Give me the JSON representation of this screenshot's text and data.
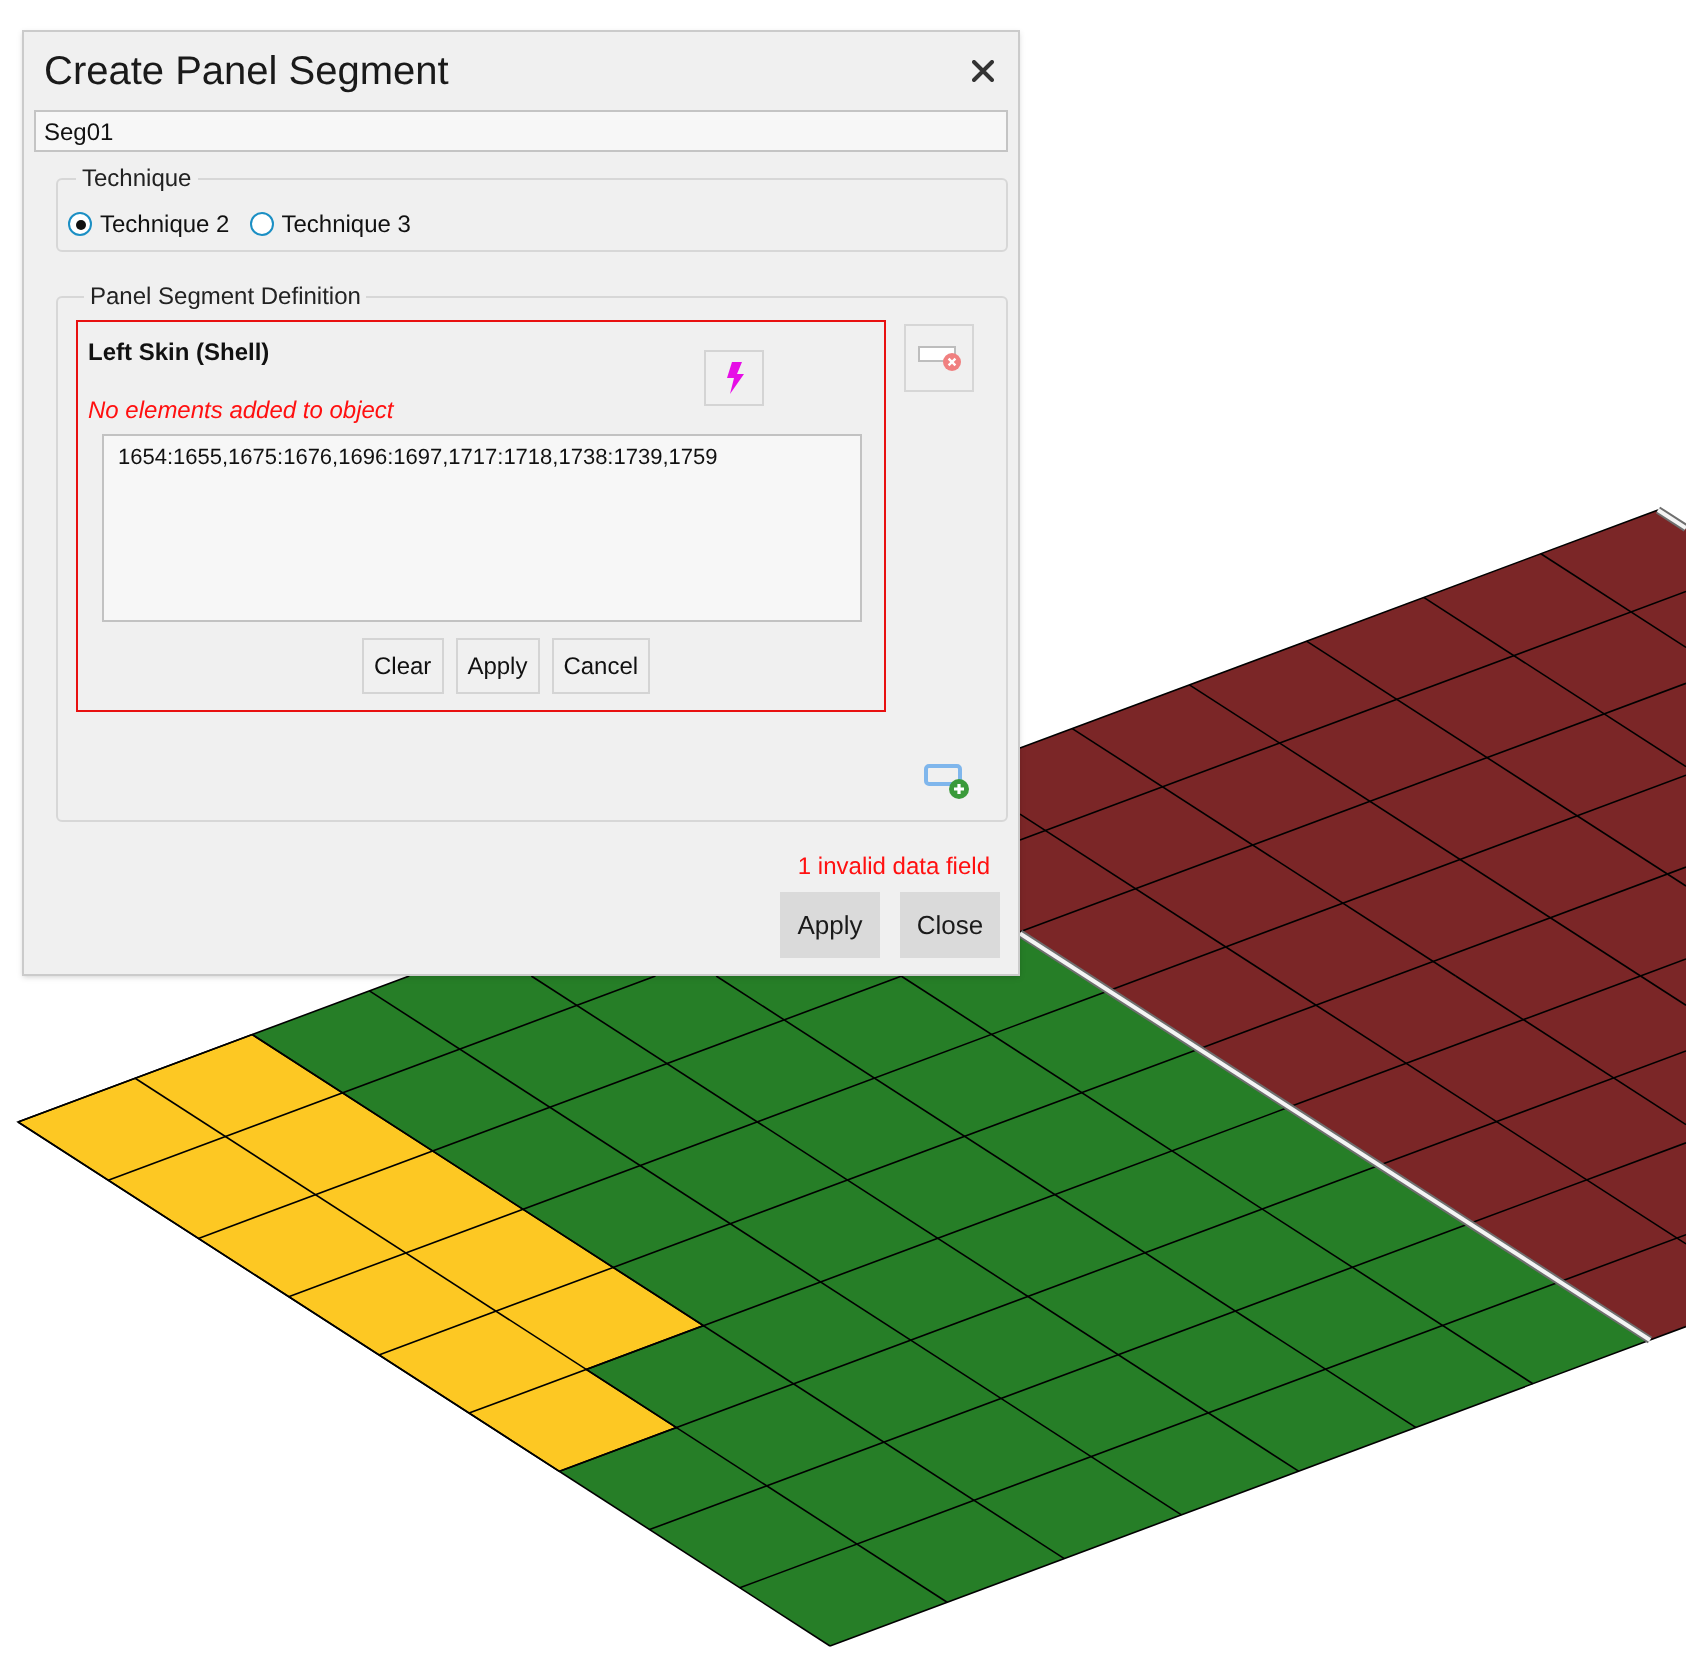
{
  "dialog": {
    "title": "Create Panel Segment",
    "name_field": {
      "value": "Seg01"
    },
    "technique": {
      "legend": "Technique",
      "options": [
        {
          "label": "Technique 2",
          "selected": true
        },
        {
          "label": "Technique 3",
          "selected": false
        }
      ]
    },
    "definition": {
      "legend": "Panel Segment Definition",
      "objects": [
        {
          "title": "Left Skin (Shell)",
          "invalid": true,
          "error": "No elements added to object",
          "elements": "1654:1655,1675:1676,1696:1697,1717:1718,1738:1739,1759",
          "buttons": [
            "Clear",
            "Apply",
            "Cancel"
          ]
        }
      ]
    },
    "validation_message": "1 invalid data field",
    "buttons": [
      "Apply",
      "Close"
    ]
  }
}
